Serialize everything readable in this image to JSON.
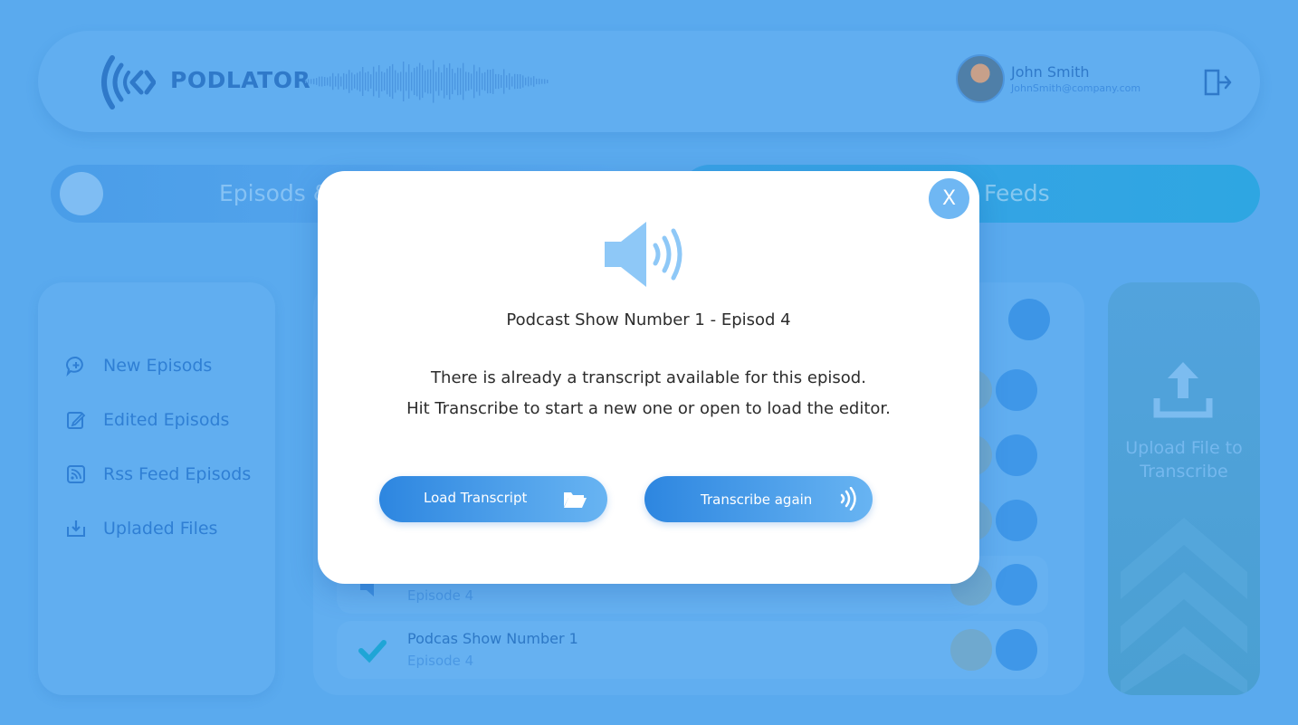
{
  "app": {
    "brand": "PODLATOR"
  },
  "user": {
    "name": "John Smith",
    "email": "JohnSmith@company.com"
  },
  "tabs": {
    "left_label": "Episods &",
    "right_label": "Feeds"
  },
  "sidebar": {
    "items": [
      {
        "label": "New Episods",
        "icon": "chat-plus-icon"
      },
      {
        "label": "Edited Episods",
        "icon": "edit-icon"
      },
      {
        "label": "Rss Feed Episods",
        "icon": "rss-icon"
      },
      {
        "label": "Upladed Files",
        "icon": "download-icon"
      }
    ]
  },
  "episodes": {
    "rows": [
      {
        "title": "",
        "subtitle": "Episode 4"
      },
      {
        "title": "Podcas Show Number 1",
        "subtitle": "Episode 4"
      }
    ]
  },
  "upload": {
    "label": "Upload File to Transcribe"
  },
  "modal": {
    "close_label": "X",
    "title": "Podcast Show Number 1 - Episod 4",
    "message_line1": "There is already a transcript available for this episod.",
    "message_line2": "Hit Transcribe to start a new one or open to load the editor.",
    "load_button": "Load Transcript",
    "transcribe_button": "Transcribe again"
  },
  "colors": {
    "background": "#5aaaee",
    "accent": "#2d86e0",
    "modal": "#ffffff"
  }
}
